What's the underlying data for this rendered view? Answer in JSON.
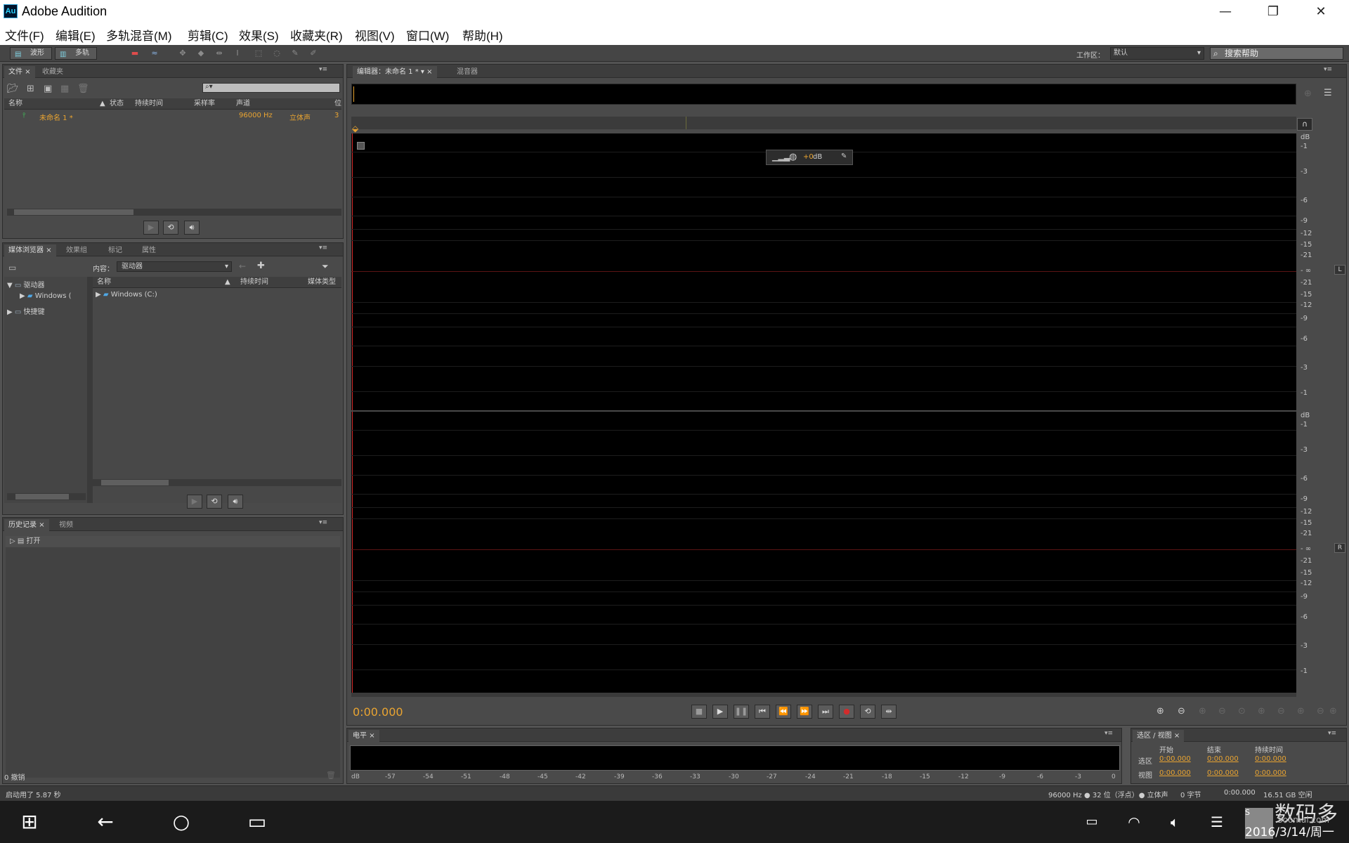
{
  "window": {
    "app_badge": "Au",
    "title": "Adobe Audition",
    "minimize": "—",
    "restore": "❐",
    "close": "✕"
  },
  "menu": [
    "文件(F)",
    "编辑(E)",
    "多轨混音(M)",
    "剪辑(C)",
    "效果(S)",
    "收藏夹(R)",
    "视图(V)",
    "窗口(W)",
    "帮助(H)"
  ],
  "toolbar": {
    "waveform": "波形",
    "multitrack": "多轨",
    "workspace_label": "工作区：",
    "workspace_value": "默认",
    "search_placeholder": "搜索帮助"
  },
  "files_panel": {
    "tabs": [
      "文件",
      "收藏夹"
    ],
    "columns": [
      "名称",
      "状态",
      "持续时间",
      "采样率",
      "声道",
      "位"
    ],
    "rows": [
      {
        "name": "未命名 1 *",
        "status": "",
        "duration": "",
        "rate": "96000 Hz",
        "channels": "立体声",
        "bits": "3"
      }
    ]
  },
  "media_panel": {
    "tabs": [
      "媒体浏览器",
      "效果组",
      "标记",
      "属性"
    ],
    "content_label": "内容：",
    "content_value": "驱动器",
    "tree": [
      "驱动器",
      "Windows (",
      "快捷键"
    ],
    "columns": [
      "名称",
      "持续时间",
      "媒体类型"
    ],
    "rows": [
      "Windows (C:)"
    ]
  },
  "history_panel": {
    "tabs": [
      "历史记录",
      "视频"
    ],
    "items": [
      "打开"
    ],
    "footer": "0 撤销"
  },
  "editor": {
    "tabs": [
      "编辑器：未命名 1 *",
      "混音器"
    ],
    "volume": "+0",
    "volume_unit": "dB",
    "ruler_top": [
      "dB",
      "-1",
      "-3",
      "-6",
      "-9",
      "-12",
      "-15",
      "-21",
      "- ∞",
      "-21",
      "-15",
      "-12",
      "-9",
      "-6",
      "-3",
      "-1"
    ],
    "ruler_bottom": [
      "dB",
      "-1",
      "-3",
      "-6",
      "-9",
      "-12",
      "-15",
      "-21",
      "- ∞",
      "-21",
      "-15",
      "-12",
      "-9",
      "-6",
      "-3",
      "-1"
    ],
    "ch_left": "L",
    "ch_right": "R",
    "time": "0:00.000"
  },
  "levels_panel": {
    "tab": "电平",
    "scale": [
      "dB",
      "-57",
      "-54",
      "-51",
      "-48",
      "-45",
      "-42",
      "-39",
      "-36",
      "-33",
      "-30",
      "-27",
      "-24",
      "-21",
      "-18",
      "-15",
      "-12",
      "-9",
      "-6",
      "-3",
      "0"
    ]
  },
  "selection_panel": {
    "tab": "选区 / 视图",
    "headers": [
      "开始",
      "结束",
      "持续时间"
    ],
    "rows": [
      {
        "label": "选区",
        "start": "0:00.000",
        "end": "0:00.000",
        "dur": "0:00.000"
      },
      {
        "label": "视图",
        "start": "0:00.000",
        "end": "0:00.000",
        "dur": "0:00.000"
      }
    ]
  },
  "statusbar": {
    "left": "启动用了 5.87 秒",
    "format": "96000 Hz ● 32 位（浮点）● 立体声",
    "bytes": "0 字节",
    "duration": "0:00.000",
    "space": "16.51 GB 空闲"
  },
  "taskbar": {
    "date": "2016/3/14/周一",
    "watermark": "数码多",
    "watermark_site": "Soomal.com"
  }
}
